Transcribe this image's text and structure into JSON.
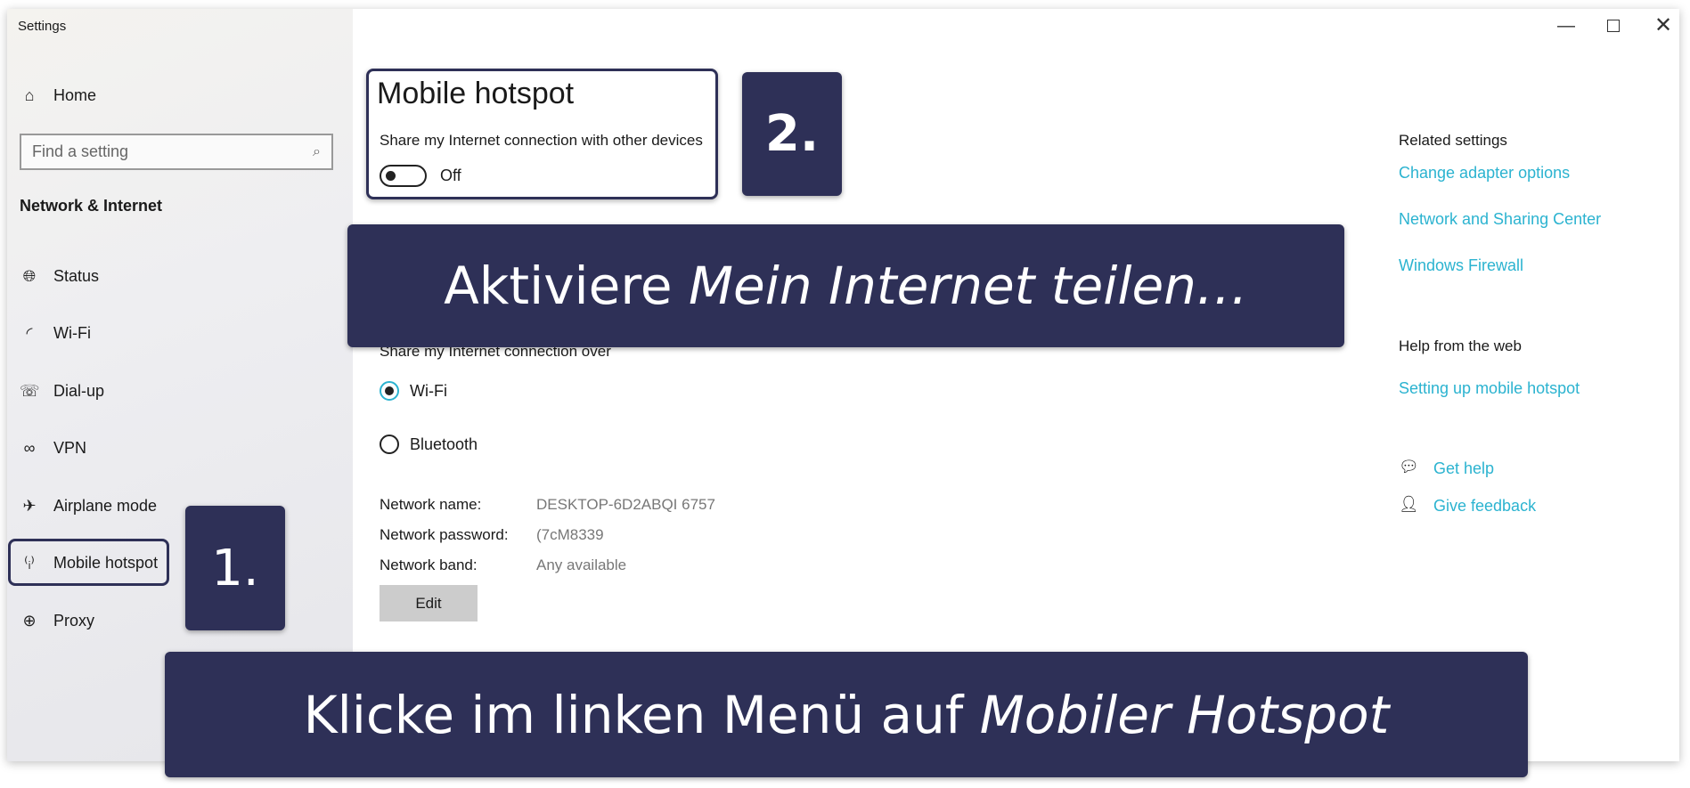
{
  "window": {
    "title": "Settings",
    "controls": [
      "minimize",
      "restore",
      "close"
    ]
  },
  "sidebar": {
    "home": "Home",
    "search_placeholder": "Find a setting",
    "section": "Network & Internet",
    "items": [
      {
        "label": "Status",
        "icon": "globe-status-icon"
      },
      {
        "label": "Wi-Fi",
        "icon": "wifi-icon"
      },
      {
        "label": "Dial-up",
        "icon": "dialup-icon"
      },
      {
        "label": "VPN",
        "icon": "vpn-icon"
      },
      {
        "label": "Airplane mode",
        "icon": "airplane-icon"
      },
      {
        "label": "Mobile hotspot",
        "icon": "hotspot-icon",
        "selected": true
      },
      {
        "label": "Proxy",
        "icon": "globe-icon"
      }
    ]
  },
  "main": {
    "title": "Mobile hotspot",
    "share_label": "Share my Internet connection with other devices",
    "toggle_state": "Off",
    "share_over_label": "Share my Internet connection over",
    "options": [
      {
        "label": "Wi-Fi",
        "selected": true
      },
      {
        "label": "Bluetooth",
        "selected": false
      }
    ],
    "network": [
      {
        "label": "Network name:",
        "value": "DESKTOP-6D2ABQI 6757"
      },
      {
        "label": "Network password:",
        "value": "(7cM8339"
      },
      {
        "label": "Network band:",
        "value": "Any available"
      }
    ],
    "edit": "Edit"
  },
  "right": {
    "related_title": "Related settings",
    "related_links": [
      "Change adapter options",
      "Network and Sharing Center",
      "Windows Firewall"
    ],
    "help_title": "Help from the web",
    "help_links": [
      "Setting up mobile hotspot"
    ],
    "get_help": "Get help",
    "give_feedback": "Give feedback"
  },
  "annotations": {
    "step1": "1.",
    "step2": "2.",
    "banner_top_plain": "Aktiviere ",
    "banner_top_italic": "Mein Internet teilen…",
    "banner_bottom_plain": "Klicke im linken Menü auf ",
    "banner_bottom_italic": "Mobiler Hotspot"
  },
  "colors": {
    "accent": "#2bb3d0",
    "annotation": "#2e3057"
  }
}
